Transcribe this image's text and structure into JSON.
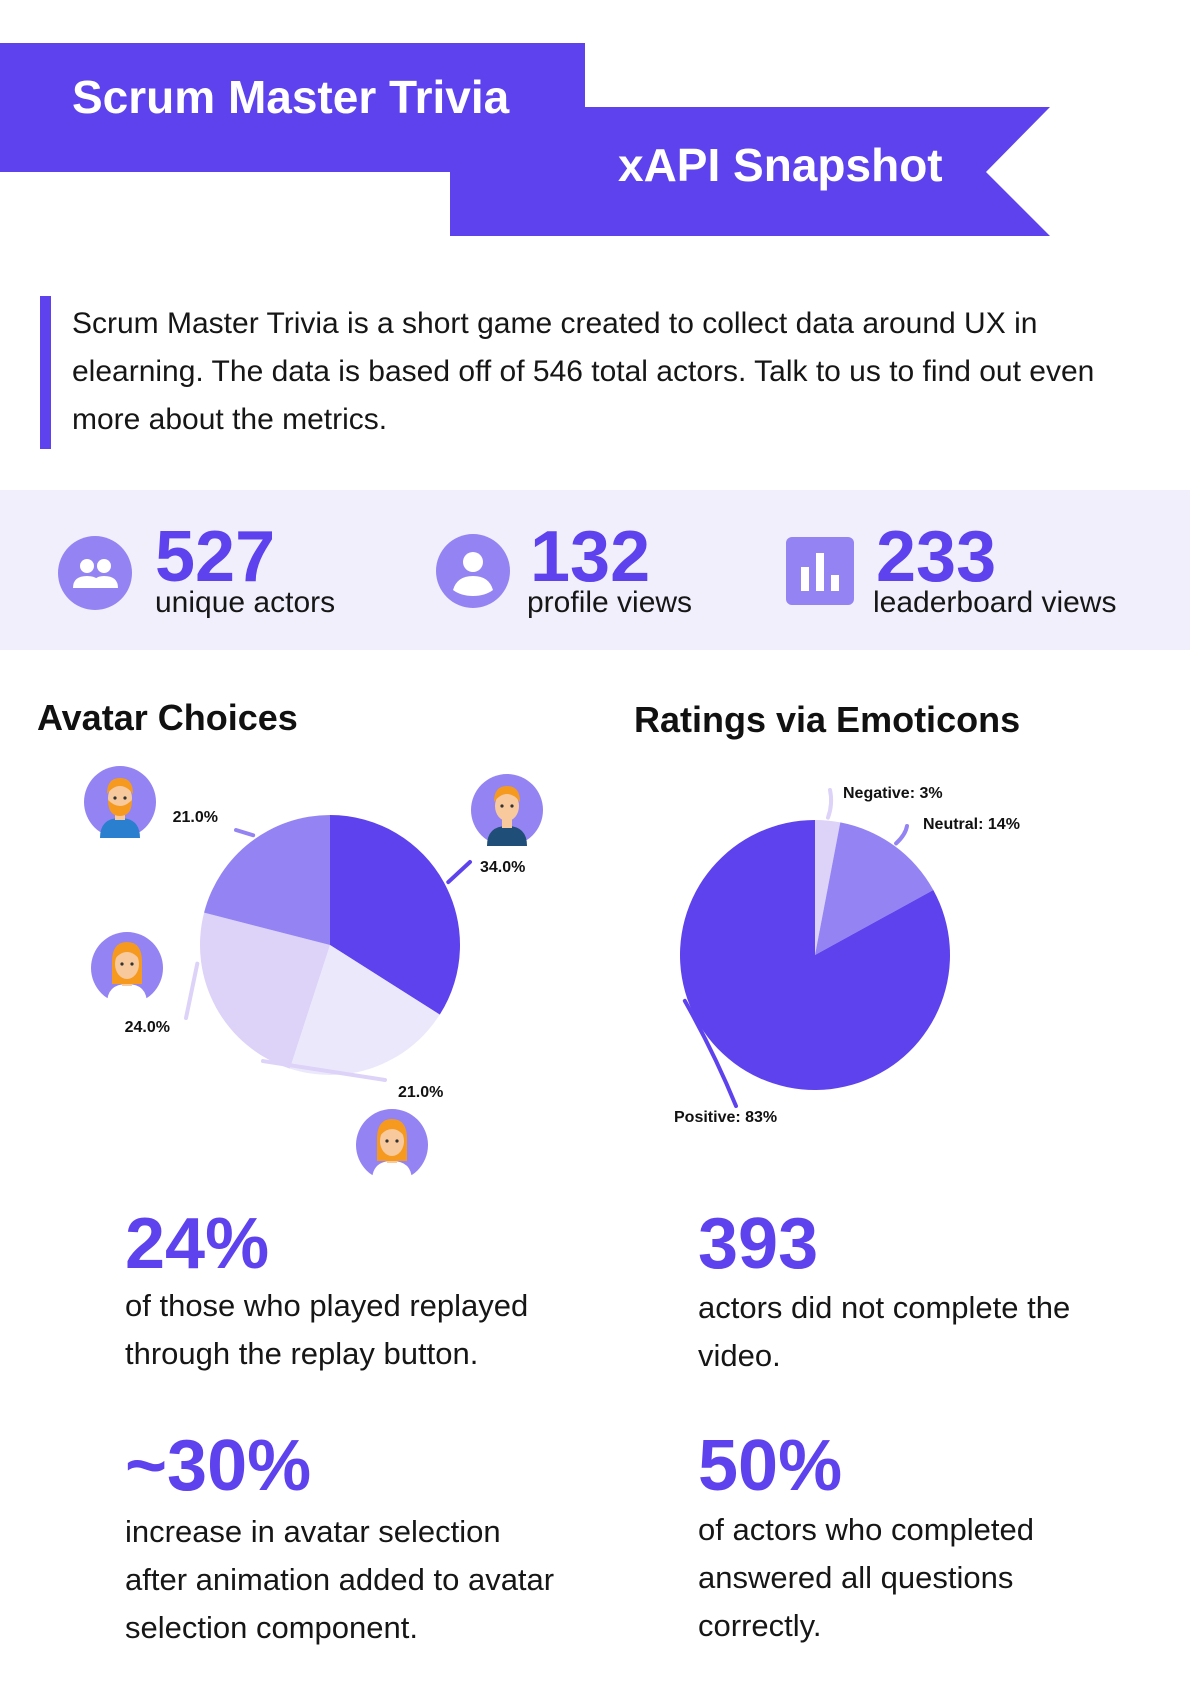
{
  "header": {
    "title": "Scrum Master Trivia",
    "subtitle": "xAPI Snapshot",
    "accent_color": "#5d42ed",
    "dark_accent_color": "#2a17a8"
  },
  "intro": {
    "text": "Scrum Master Trivia is a short game created to collect data around UX in elearning. The data is based off of 546 total actors. Talk to us to find out even more about the metrics."
  },
  "stats": [
    {
      "icon": "group-icon",
      "value": "527",
      "label": "unique actors"
    },
    {
      "icon": "person-icon",
      "value": "132",
      "label": "profile views"
    },
    {
      "icon": "bar-chart-icon",
      "value": "233",
      "label": "leaderboard views"
    }
  ],
  "avatar_section": {
    "title": "Avatar Choices"
  },
  "ratings_section": {
    "title": "Ratings via Emoticons"
  },
  "chart_data": [
    {
      "type": "pie",
      "title": "Avatar Choices",
      "slices": [
        {
          "label": "34.0%",
          "value": 34.0,
          "color": "#5d42ed",
          "avatar": "boy-avatar-icon"
        },
        {
          "label": "21.0%",
          "value": 21.0,
          "color": "#ece8fc",
          "avatar": "girl-long-hair-avatar-icon"
        },
        {
          "label": "24.0%",
          "value": 24.0,
          "color": "#ddd2f8",
          "avatar": "girl-ponytail-avatar-icon"
        },
        {
          "label": "21.0%",
          "value": 21.0,
          "color": "#9483f2",
          "avatar": "bearded-man-avatar-icon"
        }
      ]
    },
    {
      "type": "pie",
      "title": "Ratings via Emoticons",
      "slices": [
        {
          "label": "Negative: 3%",
          "value": 3,
          "color": "#ddd2f8"
        },
        {
          "label": "Neutral: 14%",
          "value": 14,
          "color": "#9483f2"
        },
        {
          "label": "Positive: 83%",
          "value": 83,
          "color": "#5d42ed"
        }
      ]
    }
  ],
  "facts": [
    {
      "value": "24%",
      "text": "of those who played replayed through the replay button."
    },
    {
      "value": "393",
      "text": "actors did not complete the video."
    },
    {
      "value": "~30%",
      "text": "increase in avatar selection after animation added to avatar selection component."
    },
    {
      "value": "50%",
      "text": "of actors who completed answered all questions correctly."
    }
  ]
}
